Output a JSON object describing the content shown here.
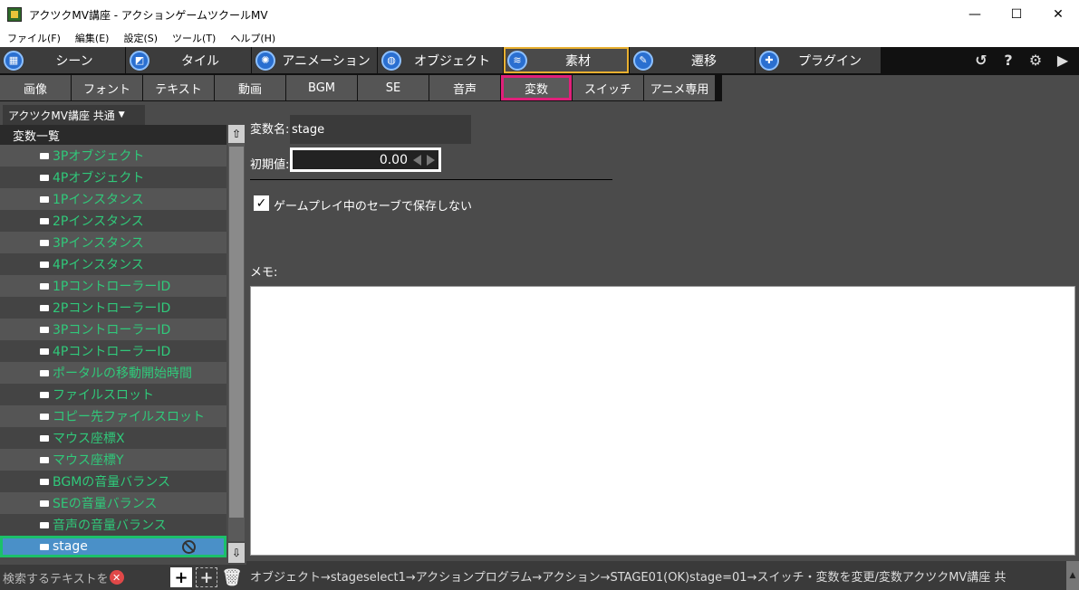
{
  "window": {
    "title": "アクツクMV講座 - アクションゲームツクールMV",
    "minimize": "—",
    "maximize": "☐",
    "close": "✕"
  },
  "menu": [
    "ファイル(F)",
    "編集(E)",
    "設定(S)",
    "ツール(T)",
    "ヘルプ(H)"
  ],
  "main_tabs": [
    {
      "label": "シーン",
      "icon": "scene-icon",
      "glyph": "▦"
    },
    {
      "label": "タイル",
      "icon": "tile-icon",
      "glyph": "◩"
    },
    {
      "label": "アニメーション",
      "icon": "animation-icon",
      "glyph": "✺"
    },
    {
      "label": "オブジェクト",
      "icon": "object-icon",
      "glyph": "◍"
    },
    {
      "label": "素材",
      "icon": "material-icon",
      "glyph": "≋",
      "active": true
    },
    {
      "label": "遷移",
      "icon": "transition-icon",
      "glyph": "✎"
    },
    {
      "label": "プラグイン",
      "icon": "plugin-icon",
      "glyph": "✚"
    }
  ],
  "toolbar_icons": {
    "refresh": "↺",
    "help": "?",
    "settings": "⚙",
    "play": "▶"
  },
  "sub_tabs": [
    "画像",
    "フォント",
    "テキスト",
    "動画",
    "BGM",
    "SE",
    "音声",
    "変数",
    "スイッチ",
    "アニメ専用"
  ],
  "sub_tab_active": "変数",
  "left": {
    "project": "アクツクMV講座 共通",
    "list_header": "変数一覧",
    "items": [
      "3Pオブジェクト",
      "4Pオブジェクト",
      "1Pインスタンス",
      "2Pインスタンス",
      "3Pインスタンス",
      "4Pインスタンス",
      "1PコントローラーID",
      "2PコントローラーID",
      "3PコントローラーID",
      "4PコントローラーID",
      "ポータルの移動開始時間",
      "ファイルスロット",
      "コピー先ファイルスロット",
      "マウス座標X",
      "マウス座標Y",
      "BGMの音量バランス",
      "SEの音量バランス",
      "音声の音量バランス"
    ],
    "selected_item": "stage",
    "search_placeholder": "検索するテキストを",
    "clear_glyph": "✕",
    "add_glyph": "+",
    "add_folder_glyph": "+",
    "delete_glyph": "🗑"
  },
  "right": {
    "var_name_label": "変数名:",
    "var_name_value": "stage",
    "init_label": "初期値:",
    "init_value": "0.00",
    "checkbox_checked": true,
    "checkbox_label": "ゲームプレイ中のセーブで保存しない",
    "memo_label": "メモ:",
    "memo_value": "",
    "status": "オブジェクト→stageselect1→アクションプログラム→アクション→STAGE01(OK)stage=01→スイッチ・変数を変更/変数アクツクMV講座 共"
  },
  "colors": {
    "accent_main_tab": "#e8b030",
    "accent_sub_tab": "#e0207a",
    "list_text": "#30c97a",
    "selected_row": "#4a90c8",
    "selected_outline": "#1cc06a"
  }
}
